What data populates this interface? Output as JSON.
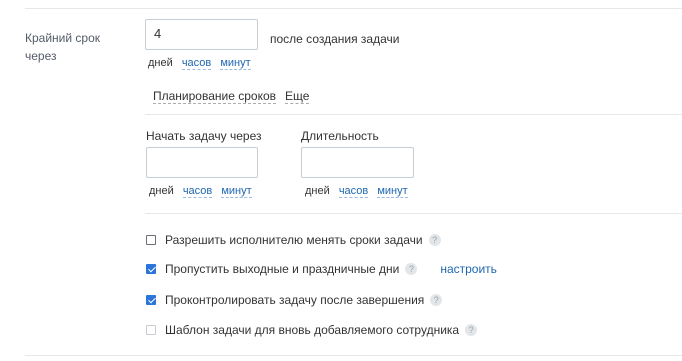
{
  "deadline": {
    "label": "Крайний срок через",
    "value": "4",
    "suffix": "после создания задачи",
    "units": {
      "days": "дней",
      "hours": "часов",
      "minutes": "минут"
    }
  },
  "tabs": {
    "planning": "Планирование сроков",
    "more": "Еще"
  },
  "start": {
    "label": "Начать задачу через",
    "value": "",
    "units": {
      "days": "дней",
      "hours": "часов",
      "minutes": "минут"
    }
  },
  "duration": {
    "label": "Длительность",
    "value": "",
    "units": {
      "days": "дней",
      "hours": "часов",
      "minutes": "минут"
    }
  },
  "options": [
    {
      "label": "Разрешить исполнителю менять сроки задачи",
      "checked": false,
      "help": "?"
    },
    {
      "label": "Пропустить выходные и праздничные дни",
      "checked": true,
      "help": "?",
      "link": "настроить"
    },
    {
      "label": "Проконтролировать задачу после завершения",
      "checked": true,
      "help": "?"
    },
    {
      "label": "Шаблон задачи для вновь добавляемого сотрудника",
      "checked": false,
      "disabled": true,
      "help": "?"
    }
  ]
}
